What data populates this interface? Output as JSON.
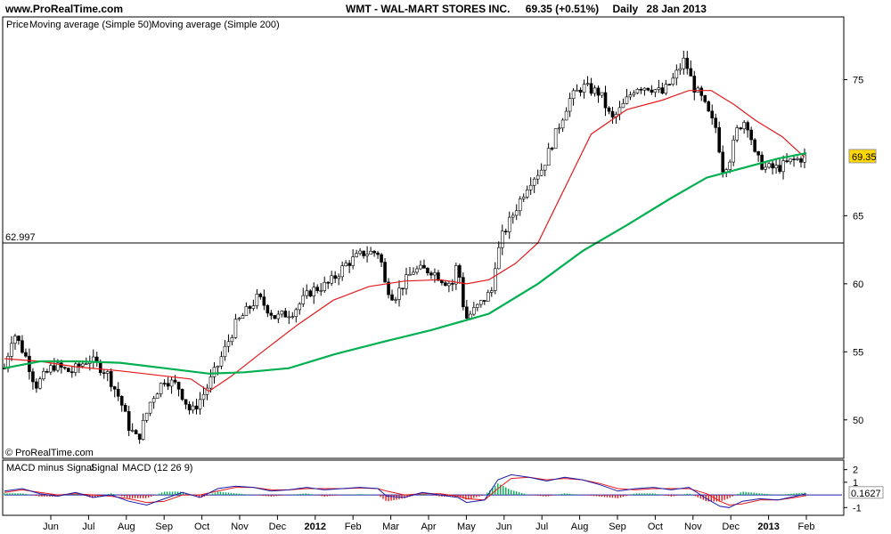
{
  "header": {
    "site": "www.ProRealTime.com",
    "instrument": "WMT - WAL-MART STORES INC.",
    "quote": "69.35 (+0.51%)",
    "period": "Daily",
    "date": "28 Jan 2013"
  },
  "chart_data": [
    {
      "type": "line",
      "panel": "price",
      "legend": {
        "label": "Price",
        "items": [
          {
            "name": "Moving average (Simple 50)",
            "color": "#e31a1c"
          },
          {
            "name": "Moving average (Simple 200)",
            "color": "#00b050"
          }
        ]
      },
      "x_ticks": [
        "Jun",
        "Jul",
        "Aug",
        "Sep",
        "Oct",
        "Nov",
        "Dec",
        "2012",
        "Feb",
        "Mar",
        "Apr",
        "May",
        "Jun",
        "Jul",
        "Aug",
        "Sep",
        "Oct",
        "Nov",
        "Dec",
        "2013",
        "Feb"
      ],
      "y_ticks": [
        50,
        55,
        60,
        65,
        75
      ],
      "ylim": [
        47.5,
        78.5
      ],
      "horizontal_line": {
        "value": 62.997,
        "label": "62.997"
      },
      "last_value": {
        "value": 69.35,
        "label": "69.35",
        "color": "#ffd700"
      },
      "candle_color_up": "#ffffff",
      "candle_color_down": "#000000",
      "price_anchors": [
        [
          0,
          53.8
        ],
        [
          10,
          56.5
        ],
        [
          25,
          54.5
        ],
        [
          35,
          52.5
        ],
        [
          55,
          54
        ],
        [
          75,
          53.5
        ],
        [
          95,
          54.5
        ],
        [
          115,
          53.5
        ],
        [
          130,
          51.5
        ],
        [
          140,
          49.5
        ],
        [
          150,
          48.5
        ],
        [
          165,
          51.5
        ],
        [
          180,
          53
        ],
        [
          195,
          52.5
        ],
        [
          210,
          50.5
        ],
        [
          225,
          52
        ],
        [
          240,
          54
        ],
        [
          260,
          57
        ],
        [
          285,
          59
        ],
        [
          305,
          57.5
        ],
        [
          325,
          58
        ],
        [
          345,
          59.5
        ],
        [
          365,
          60
        ],
        [
          385,
          61.5
        ],
        [
          405,
          62.3
        ],
        [
          422,
          62.3
        ],
        [
          428,
          60
        ],
        [
          438,
          59
        ],
        [
          460,
          61
        ],
        [
          480,
          61
        ],
        [
          495,
          60.2
        ],
        [
          505,
          60
        ],
        [
          510,
          62
        ],
        [
          514,
          59
        ],
        [
          520,
          57.5
        ],
        [
          535,
          58.5
        ],
        [
          548,
          59.5
        ],
        [
          552,
          61.5
        ],
        [
          560,
          63.5
        ],
        [
          575,
          65.5
        ],
        [
          590,
          67.5
        ],
        [
          605,
          68.5
        ],
        [
          620,
          71
        ],
        [
          635,
          73.5
        ],
        [
          650,
          74.5
        ],
        [
          670,
          74
        ],
        [
          683,
          72
        ],
        [
          695,
          73
        ],
        [
          710,
          74.5
        ],
        [
          725,
          74.5
        ],
        [
          740,
          74
        ],
        [
          752,
          75
        ],
        [
          765,
          76.5
        ],
        [
          775,
          74.5
        ],
        [
          785,
          73.5
        ],
        [
          795,
          72
        ],
        [
          800,
          71.5
        ],
        [
          808,
          68.5
        ],
        [
          815,
          69
        ],
        [
          825,
          71.5
        ],
        [
          833,
          72
        ],
        [
          838,
          71.5
        ],
        [
          843,
          69.5
        ],
        [
          855,
          68.5
        ],
        [
          870,
          68.5
        ],
        [
          885,
          69
        ],
        [
          895,
          69.2
        ],
        [
          902,
          69.35
        ]
      ],
      "sma50": [
        [
          0,
          54.5
        ],
        [
          40,
          54.3
        ],
        [
          80,
          53.9
        ],
        [
          130,
          53.6
        ],
        [
          170,
          53.3
        ],
        [
          210,
          53
        ],
        [
          230,
          52.1
        ],
        [
          255,
          53.2
        ],
        [
          290,
          55
        ],
        [
          330,
          57
        ],
        [
          370,
          58.8
        ],
        [
          410,
          59.8
        ],
        [
          450,
          60.2
        ],
        [
          490,
          60.3
        ],
        [
          520,
          60
        ],
        [
          545,
          60.3
        ],
        [
          575,
          61.5
        ],
        [
          600,
          63
        ],
        [
          630,
          67
        ],
        [
          660,
          71
        ],
        [
          700,
          72.8
        ],
        [
          740,
          73.5
        ],
        [
          770,
          74.2
        ],
        [
          795,
          74.2
        ],
        [
          820,
          73.2
        ],
        [
          845,
          72
        ],
        [
          875,
          70.8
        ],
        [
          900,
          69.3
        ]
      ],
      "sma200": [
        [
          0,
          53.8
        ],
        [
          40,
          54.3
        ],
        [
          80,
          54.3
        ],
        [
          130,
          54.2
        ],
        [
          180,
          53.8
        ],
        [
          230,
          53.4
        ],
        [
          270,
          53.5
        ],
        [
          320,
          53.8
        ],
        [
          370,
          54.8
        ],
        [
          430,
          55.8
        ],
        [
          480,
          56.6
        ],
        [
          545,
          57.8
        ],
        [
          600,
          60
        ],
        [
          650,
          62.4
        ],
        [
          700,
          64.3
        ],
        [
          750,
          66.3
        ],
        [
          790,
          67.8
        ],
        [
          830,
          68.5
        ],
        [
          870,
          69.2
        ],
        [
          902,
          69.6
        ]
      ]
    },
    {
      "type": "line",
      "panel": "macd",
      "legend": {
        "items": [
          {
            "name": "MACD minus Signal",
            "color": "#00b050"
          },
          {
            "name": "Signal",
            "color": "#e31a1c"
          },
          {
            "name": "MACD (12 26 9)",
            "color": "#1a1aa8"
          }
        ]
      },
      "y_ticks": [
        2,
        1,
        -1
      ],
      "ylim": [
        -1.4,
        2.4
      ],
      "last_value": {
        "value": 0.1627,
        "label": "0.1627"
      },
      "macd": [
        [
          0,
          0.3
        ],
        [
          20,
          0.5
        ],
        [
          40,
          0.1
        ],
        [
          60,
          -0.1
        ],
        [
          80,
          0.2
        ],
        [
          100,
          -0.2
        ],
        [
          120,
          0
        ],
        [
          140,
          -0.5
        ],
        [
          160,
          -0.8
        ],
        [
          180,
          -0.3
        ],
        [
          200,
          0.2
        ],
        [
          220,
          -0.2
        ],
        [
          240,
          0.5
        ],
        [
          260,
          0.7
        ],
        [
          280,
          0.6
        ],
        [
          300,
          0.3
        ],
        [
          320,
          0.4
        ],
        [
          340,
          0.6
        ],
        [
          360,
          0.4
        ],
        [
          380,
          0.5
        ],
        [
          400,
          0.6
        ],
        [
          420,
          0.5
        ],
        [
          430,
          -0.1
        ],
        [
          450,
          -0.2
        ],
        [
          470,
          0.2
        ],
        [
          490,
          0
        ],
        [
          510,
          -0.2
        ],
        [
          520,
          -0.6
        ],
        [
          540,
          -0.4
        ],
        [
          555,
          1.2
        ],
        [
          570,
          1.6
        ],
        [
          590,
          1.4
        ],
        [
          610,
          1.1
        ],
        [
          630,
          1.4
        ],
        [
          650,
          1.2
        ],
        [
          670,
          0.8
        ],
        [
          690,
          0.3
        ],
        [
          710,
          0.5
        ],
        [
          730,
          0.6
        ],
        [
          750,
          0.4
        ],
        [
          770,
          0.6
        ],
        [
          790,
          -0.3
        ],
        [
          805,
          -0.9
        ],
        [
          815,
          -1.0
        ],
        [
          830,
          -0.5
        ],
        [
          850,
          -0.3
        ],
        [
          870,
          -0.4
        ],
        [
          890,
          -0.1
        ],
        [
          902,
          0.1
        ]
      ],
      "signal": [
        [
          0,
          0.2
        ],
        [
          20,
          0.4
        ],
        [
          40,
          0.2
        ],
        [
          60,
          0
        ],
        [
          80,
          0.1
        ],
        [
          100,
          0
        ],
        [
          120,
          -0.1
        ],
        [
          140,
          -0.3
        ],
        [
          160,
          -0.6
        ],
        [
          180,
          -0.5
        ],
        [
          200,
          0
        ],
        [
          220,
          0
        ],
        [
          240,
          0.3
        ],
        [
          260,
          0.6
        ],
        [
          280,
          0.6
        ],
        [
          300,
          0.4
        ],
        [
          320,
          0.4
        ],
        [
          340,
          0.5
        ],
        [
          360,
          0.5
        ],
        [
          380,
          0.5
        ],
        [
          400,
          0.55
        ],
        [
          420,
          0.5
        ],
        [
          430,
          0.3
        ],
        [
          450,
          0
        ],
        [
          470,
          0.1
        ],
        [
          490,
          0.1
        ],
        [
          510,
          -0.1
        ],
        [
          520,
          -0.3
        ],
        [
          540,
          -0.4
        ],
        [
          555,
          0.5
        ],
        [
          570,
          1.3
        ],
        [
          590,
          1.4
        ],
        [
          610,
          1.2
        ],
        [
          630,
          1.3
        ],
        [
          650,
          1.2
        ],
        [
          670,
          0.9
        ],
        [
          690,
          0.5
        ],
        [
          710,
          0.4
        ],
        [
          730,
          0.5
        ],
        [
          750,
          0.5
        ],
        [
          770,
          0.5
        ],
        [
          790,
          0.1
        ],
        [
          805,
          -0.5
        ],
        [
          815,
          -0.8
        ],
        [
          830,
          -0.7
        ],
        [
          850,
          -0.4
        ],
        [
          870,
          -0.4
        ],
        [
          890,
          -0.2
        ],
        [
          902,
          -0.05
        ]
      ]
    }
  ],
  "copyright": "© ProRealTime.com"
}
